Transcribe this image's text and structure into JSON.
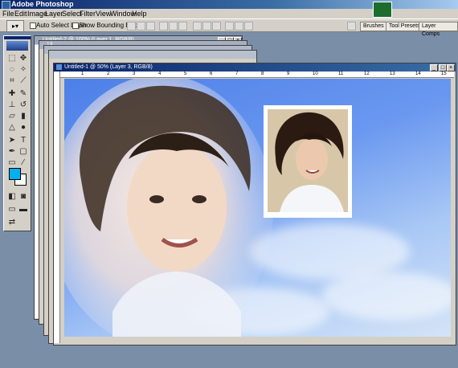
{
  "app": {
    "title": "Adobe Photoshop"
  },
  "menu": [
    "File",
    "Edit",
    "Image",
    "Layer",
    "Select",
    "Filter",
    "View",
    "Window",
    "Help"
  ],
  "options": {
    "auto_select_layer": "Auto Select Layer",
    "show_bounding_box": "Show Bounding Box"
  },
  "palette_well": {
    "tabs": [
      "Brushes",
      "Tool Presets",
      "Layer Comps"
    ]
  },
  "documents": {
    "doc_back": {
      "title": "Untitled-2 @ 100% (Layer 1, RGB/8)"
    },
    "doc_back_left": {
      "title": "Ui"
    },
    "doc_front": {
      "title": "Untitled-1 @ 50% (Layer 3, RGB/8)"
    }
  },
  "ruler_front": [
    "1",
    "2",
    "3",
    "4",
    "5",
    "6",
    "7",
    "8",
    "9",
    "10",
    "11",
    "12",
    "13",
    "14",
    "15"
  ],
  "colors": {
    "foreground": "#00b0f0",
    "background": "#ffffff",
    "title_active": "#0a246a"
  },
  "icons": [
    "move-tool-icon",
    "marquee-tool-icon",
    "lasso-tool-icon",
    "crop-tool-icon",
    "brush-tool-icon",
    "stamp-tool-icon",
    "eraser-tool-icon",
    "gradient-tool-icon",
    "pen-tool-icon",
    "type-tool-icon",
    "hand-tool-icon",
    "zoom-tool-icon"
  ]
}
